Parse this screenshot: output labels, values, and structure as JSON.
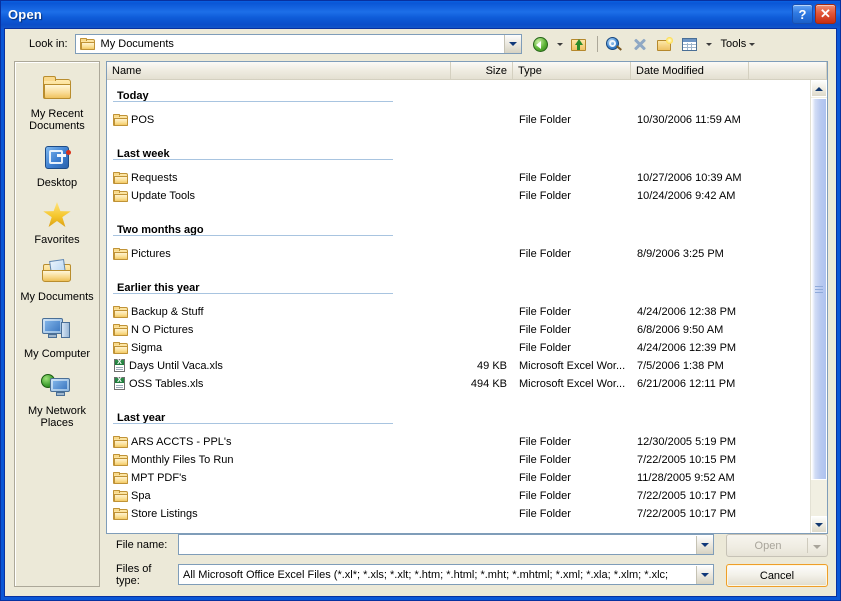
{
  "window": {
    "title": "Open",
    "help_button": "?",
    "close_button": "✕"
  },
  "lookin": {
    "label": "Look in:",
    "value": "My Documents",
    "icon": "folder-icon"
  },
  "toolbar": {
    "back_icon": "back-arrow-icon",
    "back_dropdown_icon": "chevron-down-icon",
    "up_icon": "up-one-level-icon",
    "search_icon": "search-the-web-icon",
    "delete_icon": "delete-icon",
    "new_folder_icon": "create-new-folder-icon",
    "views_icon": "views-icon",
    "views_dropdown_icon": "chevron-down-icon",
    "tools_label": "Tools",
    "tools_dropdown_icon": "chevron-down-icon"
  },
  "places": {
    "items": [
      {
        "label": "My Recent Documents",
        "icon": "recent-documents-icon"
      },
      {
        "label": "Desktop",
        "icon": "desktop-icon"
      },
      {
        "label": "Favorites",
        "icon": "favorites-star-icon"
      },
      {
        "label": "My Documents",
        "icon": "my-documents-icon"
      },
      {
        "label": "My Computer",
        "icon": "my-computer-icon"
      },
      {
        "label": "My Network Places",
        "icon": "my-network-places-icon"
      }
    ]
  },
  "filelist": {
    "columns": [
      "Name",
      "Size",
      "Type",
      "Date Modified"
    ],
    "groups": [
      {
        "header": "Today",
        "rows": [
          {
            "icon": "folder-icon",
            "name": "POS",
            "size": "",
            "type": "File Folder",
            "date": "10/30/2006 11:59 AM"
          }
        ]
      },
      {
        "header": "Last week",
        "rows": [
          {
            "icon": "folder-icon",
            "name": "Requests",
            "size": "",
            "type": "File Folder",
            "date": "10/27/2006 10:39 AM"
          },
          {
            "icon": "folder-icon",
            "name": "Update Tools",
            "size": "",
            "type": "File Folder",
            "date": "10/24/2006 9:42 AM"
          }
        ]
      },
      {
        "header": "Two months ago",
        "rows": [
          {
            "icon": "folder-icon",
            "name": "Pictures",
            "size": "",
            "type": "File Folder",
            "date": "8/9/2006 3:25 PM"
          }
        ]
      },
      {
        "header": "Earlier this year",
        "rows": [
          {
            "icon": "folder-icon",
            "name": "Backup & Stuff",
            "size": "",
            "type": "File Folder",
            "date": "4/24/2006 12:38 PM"
          },
          {
            "icon": "folder-icon",
            "name": "N O Pictures",
            "size": "",
            "type": "File Folder",
            "date": "6/8/2006 9:50 AM"
          },
          {
            "icon": "folder-icon",
            "name": "Sigma",
            "size": "",
            "type": "File Folder",
            "date": "4/24/2006 12:39 PM"
          },
          {
            "icon": "excel-file-icon",
            "name": "Days Until Vaca.xls",
            "size": "49 KB",
            "type": "Microsoft Excel Wor...",
            "date": "7/5/2006 1:38 PM"
          },
          {
            "icon": "excel-file-icon",
            "name": "OSS Tables.xls",
            "size": "494 KB",
            "type": "Microsoft Excel Wor...",
            "date": "6/21/2006 12:11 PM"
          }
        ]
      },
      {
        "header": "Last year",
        "rows": [
          {
            "icon": "folder-icon",
            "name": "ARS ACCTS - PPL's",
            "size": "",
            "type": "File Folder",
            "date": "12/30/2005 5:19 PM"
          },
          {
            "icon": "folder-icon",
            "name": "Monthly Files To Run",
            "size": "",
            "type": "File Folder",
            "date": "7/22/2005 10:15 PM"
          },
          {
            "icon": "folder-icon",
            "name": "MPT PDF's",
            "size": "",
            "type": "File Folder",
            "date": "11/28/2005 9:52 AM"
          },
          {
            "icon": "folder-icon",
            "name": "Spa",
            "size": "",
            "type": "File Folder",
            "date": "7/22/2005 10:17 PM"
          },
          {
            "icon": "folder-icon",
            "name": "Store Listings",
            "size": "",
            "type": "File Folder",
            "date": "7/22/2005 10:17 PM"
          }
        ]
      }
    ],
    "scrollbar": {
      "up_icon": "scroll-up-icon",
      "down_icon": "scroll-down-icon"
    }
  },
  "footer": {
    "filename_label": "File name:",
    "filename_value": "",
    "filename_placeholder": "",
    "filetype_label": "Files of type:",
    "filetype_value": "All Microsoft Office Excel Files (*.xl*; *.xls; *.xlt; *.htm; *.html; *.mht; *.mhtml; *.xml; *.xla; *.xlm; *.xlc;",
    "open_label": "Open",
    "cancel_label": "Cancel"
  },
  "colors": {
    "titlebar_blue": "#0a56d6",
    "dialog_face": "#ece9d8",
    "list_background": "#ffffff",
    "group_rule": "#a8c4e0",
    "cancel_focus": "#ee9e28",
    "scrollbar_thumb": "#b9caf0"
  }
}
